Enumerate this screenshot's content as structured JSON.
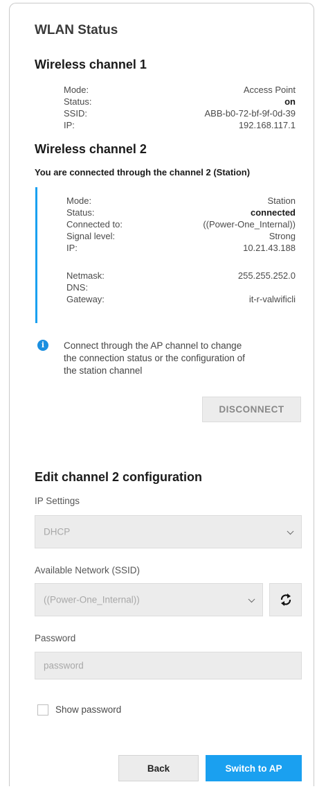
{
  "title": "WLAN Status",
  "channel1": {
    "heading": "Wireless channel 1",
    "rows": [
      {
        "label": "Mode:",
        "value": "Access Point"
      },
      {
        "label": "Status:",
        "value": "on"
      },
      {
        "label": "SSID:",
        "value": "ABB-b0-72-bf-9f-0d-39"
      },
      {
        "label": "IP:",
        "value": "192.168.117.1"
      }
    ]
  },
  "channel2": {
    "heading": "Wireless channel 2",
    "note": "You are connected through the channel 2 (Station)",
    "rows": [
      {
        "label": "Mode:",
        "value": "Station"
      },
      {
        "label": "Status:",
        "value": "connected"
      },
      {
        "label": "Connected to:",
        "value": "((Power-One_Internal))"
      },
      {
        "label": "Signal level:",
        "value": "Strong"
      },
      {
        "label": "IP:",
        "value": "10.21.43.188"
      },
      {
        "label": "Netmask:",
        "value": "255.255.252.0"
      },
      {
        "label": "DNS:",
        "value": ""
      },
      {
        "label": "Gateway:",
        "value": "it-r-valwificli"
      }
    ],
    "info": [
      "Connect through the AP channel to change",
      "the connection status or the configuration of",
      "the station channel"
    ],
    "disconnect_label": "DISCONNECT"
  },
  "edit": {
    "heading": "Edit channel 2 configuration",
    "ip_settings_label": "IP Settings",
    "ip_settings_value": "DHCP",
    "network_label": "Available Network (SSID)",
    "network_value": "((Power-One_Internal))",
    "password_label": "Password",
    "password_placeholder": "password",
    "show_password_label": "Show password"
  },
  "buttons": {
    "back": "Back",
    "switch": "Switch to AP"
  },
  "colors": {
    "accent": "#1aa0f0",
    "info": "#1a8fe0",
    "disabled_bg": "#ececec"
  }
}
